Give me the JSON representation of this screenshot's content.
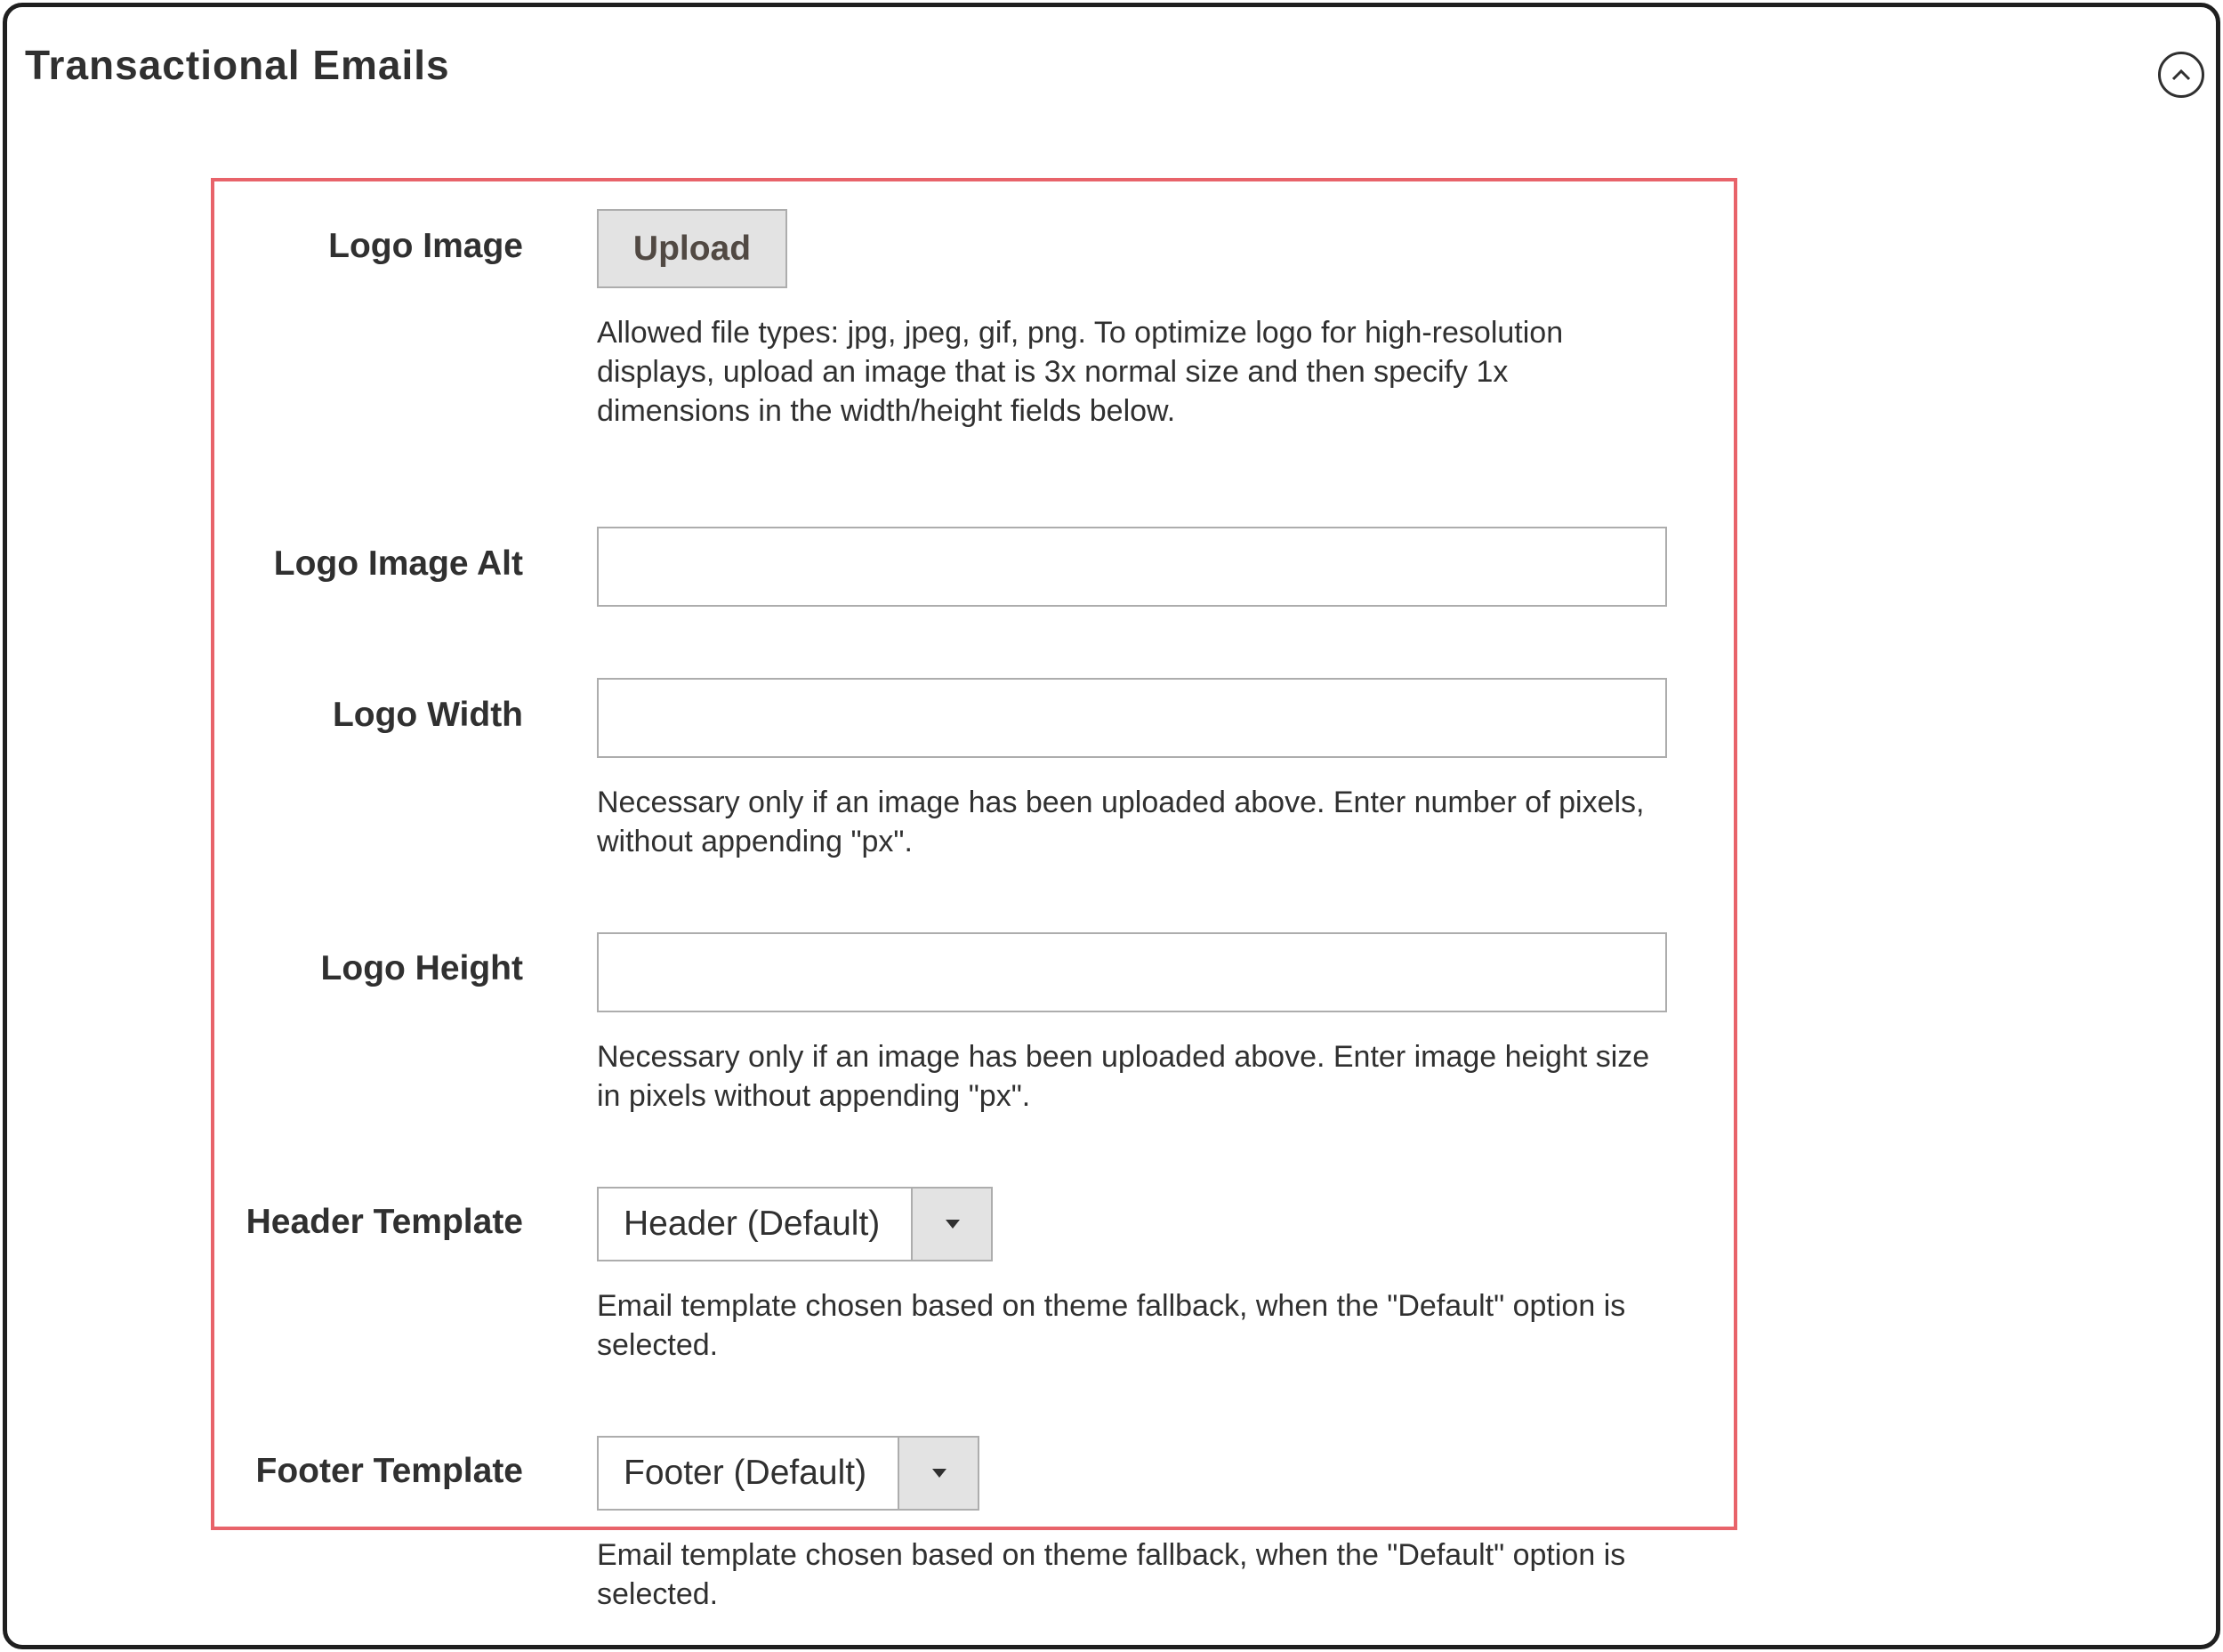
{
  "section": {
    "title": "Transactional Emails",
    "collapse_icon": "chevron-up-circle-icon"
  },
  "logo_image": {
    "label": "Logo Image",
    "button_label": "Upload",
    "note_line1": "Allowed file types: jpg, jpeg, gif, png. To optimize logo for high-resolution",
    "note_line2": "displays, upload an image that is 3x normal size and then specify 1x",
    "note_line3": "dimensions in the width/height fields below."
  },
  "logo_image_alt": {
    "label": "Logo Image Alt",
    "value": ""
  },
  "logo_width": {
    "label": "Logo Width",
    "value": "",
    "note_line1": "Necessary only if an image has been uploaded above. Enter number of pixels,",
    "note_line2": "without appending \"px\"."
  },
  "logo_height": {
    "label": "Logo Height",
    "value": "",
    "note_line1": "Necessary only if an image has been uploaded above. Enter image height size",
    "note_line2": "in pixels without appending \"px\"."
  },
  "header_template": {
    "label": "Header Template",
    "selected": "Header (Default)",
    "note_line1": "Email template chosen based on theme fallback, when the \"Default\" option is",
    "note_line2": "selected."
  },
  "footer_template": {
    "label": "Footer Template",
    "selected": "Footer (Default)",
    "note_line1": "Email template chosen based on theme fallback, when the \"Default\" option is",
    "note_line2": "selected."
  },
  "colors": {
    "highlight_border": "#e8636a",
    "button_bg": "#e3e3e3",
    "text": "#303030"
  }
}
